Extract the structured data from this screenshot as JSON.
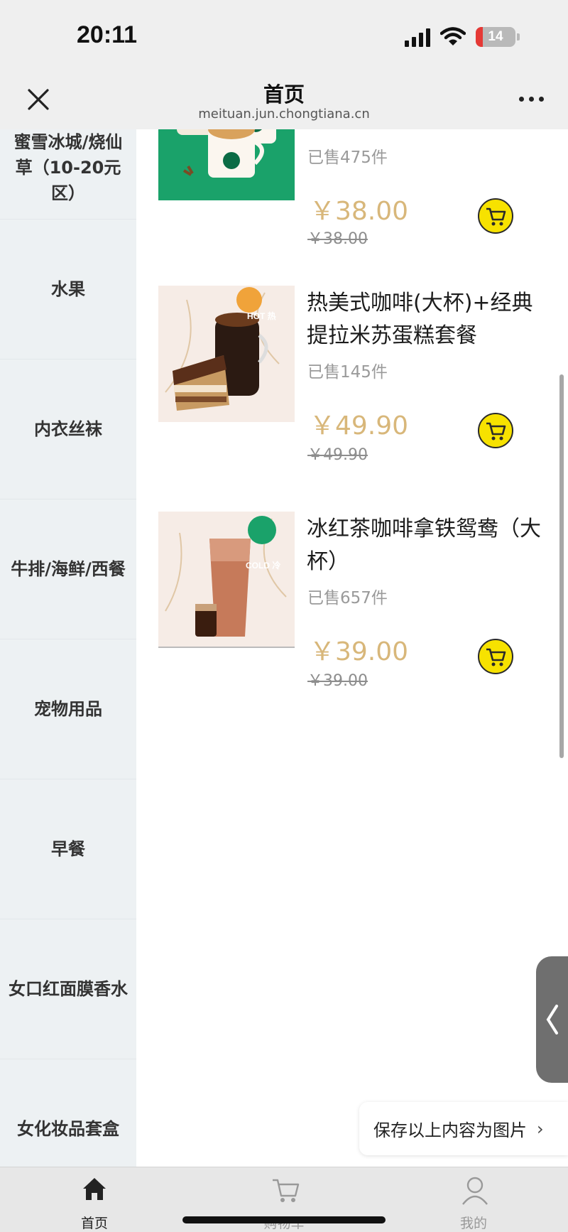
{
  "status_bar": {
    "time": "20:11",
    "battery": "14"
  },
  "nav": {
    "title": "首页",
    "url": "meituan.jun.chongtiana.cn"
  },
  "sidebar": {
    "items": [
      {
        "label": "蜜雪冰城/烧仙草（10-20元区）"
      },
      {
        "label": "水果"
      },
      {
        "label": "内衣丝袜"
      },
      {
        "label": "牛排/海鲜/西餐"
      },
      {
        "label": "宠物用品"
      },
      {
        "label": "早餐"
      },
      {
        "label": "女口红面膜香水"
      },
      {
        "label": "女化妆品套盒"
      }
    ]
  },
  "products": [
    {
      "name": "",
      "sold": "已售475件",
      "price": "￥38.00",
      "original_price": "￥38.00"
    },
    {
      "name": "热美式咖啡(大杯)+经典提拉米苏蛋糕套餐",
      "badge": "HOT 热",
      "sold": "已售145件",
      "price": "￥49.90",
      "original_price": "￥49.90"
    },
    {
      "name": "冰红茶咖啡拿铁鸳鸯（大杯）",
      "badge": "COLD 冷",
      "sold": "已售657件",
      "price": "￥39.00",
      "original_price": "￥39.00"
    }
  ],
  "save_image": {
    "label": "保存以上内容为图片",
    "chevron": "›"
  },
  "tab_bar": {
    "tabs": [
      {
        "label": "首页",
        "icon": "home-icon",
        "active": true
      },
      {
        "label": "购物车",
        "icon": "cart-icon",
        "active": false
      },
      {
        "label": "我的",
        "icon": "user-icon",
        "active": false
      }
    ]
  },
  "colors": {
    "price": "#d8b77a",
    "cart_button": "#f7e200",
    "sidebar_bg": "#edf1f3",
    "starbucks_green": "#1aa26a"
  }
}
